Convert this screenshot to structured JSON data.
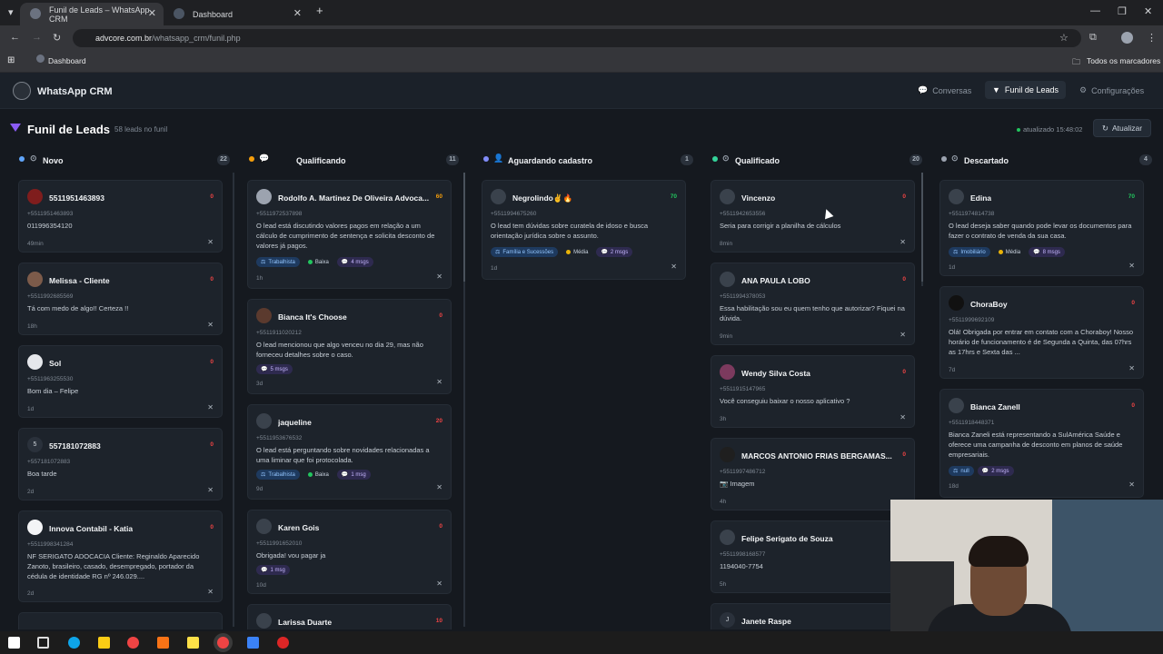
{
  "browser": {
    "tabs": [
      {
        "title": "Funil de Leads – WhatsApp CRM",
        "active": true
      },
      {
        "title": "Dashboard",
        "active": false
      }
    ],
    "url_host": "advcore.com.br",
    "url_path": "/whatsapp_crm/funil.php",
    "bookmark": "Dashboard",
    "all_bookmarks": "Todos os marcadores"
  },
  "app": {
    "brand": "WhatsApp CRM",
    "nav": {
      "conversas": "Conversas",
      "funil": "Funil de Leads",
      "config": "Configurações"
    }
  },
  "page": {
    "title": "Funil de Leads",
    "count": "58 leads no funil",
    "updated": "atualizado 15:48:02",
    "refresh": "Atualizar"
  },
  "columns": [
    {
      "title": "Novo",
      "count": "22",
      "dot": "#60a5fa",
      "cards": [
        {
          "name": "5511951463893",
          "score": "0",
          "phone": "+5511951463893",
          "text": "011996354120",
          "time": "49min"
        },
        {
          "name": "Melissa - Cliente",
          "score": "0",
          "phone": "+5511992685569",
          "text": "Tá com medo de algo!! Certeza !!",
          "time": "18h"
        },
        {
          "name": "Sol",
          "score": "0",
          "phone": "+5511963255530",
          "text": "Bom dia – Felipe",
          "time": "1d"
        },
        {
          "name": "557181072883",
          "score": "0",
          "phone": "+557181072883",
          "text": "Boa tarde",
          "time": "2d",
          "initial": "5"
        },
        {
          "name": "Innova Contabil - Katia",
          "score": "0",
          "phone": "+5511998341284",
          "text": "NF SERIGATO ADOCACIA Cliente: Reginaldo Aparecido Zanoto, brasileiro, casado, desempregado, portador da cédula de identidade RG nº 246.029....",
          "time": "2d"
        }
      ]
    },
    {
      "title": "Qualificando",
      "count": "11",
      "dot": "#f59e0b",
      "cards": [
        {
          "name": "Rodolfo A. Martinez De Oliveira Advoca...",
          "score": "60",
          "phone": "+5511972537898",
          "text": "O lead está discutindo valores pagos em relação a um cálculo de cumprimento de sentença e solicita desconto de valores já pagos.",
          "tags": [
            "Trabalhista",
            "Baixa",
            "4 msgs"
          ],
          "time": "1h"
        },
        {
          "name": "Bianca It's Choose",
          "score": "0",
          "phone": "+5511911020212",
          "text": "O lead mencionou que algo venceu no dia 29, mas não forneceu detalhes sobre o caso.",
          "tags": [
            "5 msgs"
          ],
          "time": "3d"
        },
        {
          "name": "jaqueline",
          "score": "20",
          "phone": "+5511953676532",
          "text": "O lead está perguntando sobre novidades relacionadas a uma liminar que foi protocolada.",
          "tags": [
            "Trabalhista",
            "Baixa",
            "1 msg"
          ],
          "time": "9d"
        },
        {
          "name": "Karen Gois",
          "score": "0",
          "phone": "+5511991652010",
          "text": "Obrigada! vou pagar ja",
          "tags": [
            "1 msg"
          ],
          "time": "10d"
        },
        {
          "name": "Larissa Duarte",
          "score": "10"
        }
      ]
    },
    {
      "title": "Aguardando cadastro",
      "count": "1",
      "dot": "#818cf8",
      "cards": [
        {
          "name": "Negrolindo✌️🔥",
          "score": "70",
          "phone": "+5511994675260",
          "text": "O lead tem dúvidas sobre curatela de idoso e busca orientação jurídica sobre o assunto.",
          "tags": [
            "Família e Sucessões",
            "Média",
            "2 msgs"
          ],
          "time": "1d"
        }
      ]
    },
    {
      "title": "Qualificado",
      "count": "20",
      "dot": "#34d399",
      "cards": [
        {
          "name": "Vincenzo",
          "score": "0",
          "phone": "+5511942653556",
          "text": "Seria para corrigir a planilha de cálculos",
          "time": "8min"
        },
        {
          "name": "ANA PAULA LOBO",
          "score": "0",
          "phone": "+5511994378053",
          "text": "Essa habilitação sou eu quem tenho que autorizar? Fiquei na dúvida.",
          "time": "9min"
        },
        {
          "name": "Wendy Silva Costa",
          "score": "0",
          "phone": "+5511915147965",
          "text": "Você conseguiu baixar o nosso aplicativo ?",
          "time": "3h"
        },
        {
          "name": "MARCOS ANTONIO FRIAS BERGAMAS...",
          "score": "0",
          "phone": "+5511997486712",
          "text": "📷 Imagem",
          "time": "4h"
        },
        {
          "name": "Felipe Serigato de Souza",
          "score": "0",
          "phone": "+5511998168577",
          "text": "1194040-7754",
          "time": "5h"
        },
        {
          "name": "Janete Raspe",
          "initial": "J"
        }
      ]
    },
    {
      "title": "Descartado",
      "count": "4",
      "dot": "#9ca3af",
      "cards": [
        {
          "name": "Edina",
          "score": "70",
          "phone": "+5511974814738",
          "text": "O lead deseja saber quando pode levar os documentos para fazer o contrato de venda da sua casa.",
          "tags": [
            "Imobiliário",
            "Média",
            "8 msgs"
          ],
          "time": "1d"
        },
        {
          "name": "ChoraBoy",
          "score": "0",
          "phone": "+5511999692109",
          "text": "Olá! Obrigada por entrar em contato com a Choraboy! Nosso horário de funcionamento é de Segunda a Quinta, das 07hrs as 17hrs e Sexta das ...",
          "time": "7d"
        },
        {
          "name": "Bianca Zanell",
          "score": "0",
          "phone": "+5511918448371",
          "text": "Bianca Zaneli está representando a SulAmérica Saúde e oferece uma campanha de desconto em planos de saúde empresariais.",
          "tags": [
            "null",
            "2 msgs"
          ],
          "time": "18d"
        }
      ]
    }
  ],
  "colors": {
    "accent": "#8b5cf6",
    "score_red": "#ef4444",
    "score_green": "#22c55e",
    "score_orange": "#f59e0b"
  }
}
